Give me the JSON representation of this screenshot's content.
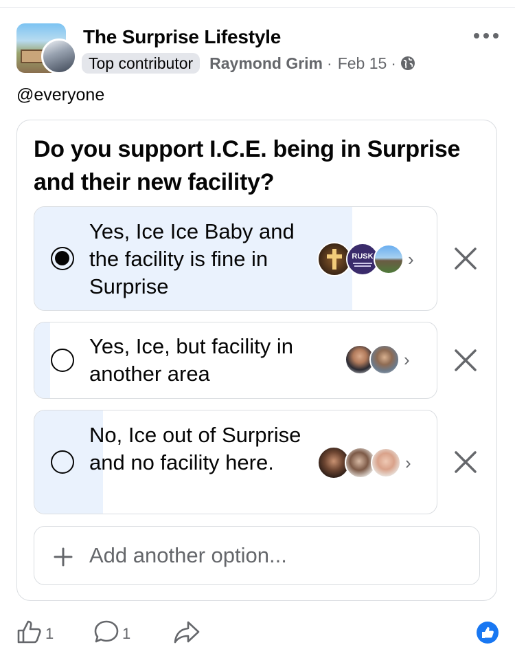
{
  "post": {
    "group_name": "The Surprise Lifestyle",
    "badge": "Top contributor",
    "author": "Raymond Grim",
    "date": "Feb 15",
    "text": "@everyone"
  },
  "poll": {
    "question": "Do you support I.C.E. being in Surprise and their new facility?",
    "options": [
      {
        "label": "Yes, Ice Ice Baby and the facility is fine in Surprise",
        "selected": true,
        "vote_share": 0.79,
        "voter_icons": [
          "cross-avatar",
          "rusk-logo-avatar",
          "building-photo-avatar"
        ]
      },
      {
        "label": "Yes, Ice, but facility in another area",
        "selected": false,
        "vote_share": 0.04,
        "voter_icons": [
          "man-avatar",
          "woman-sunglasses-avatar"
        ]
      },
      {
        "label": "No, Ice out of Surprise and no facility here.",
        "selected": false,
        "vote_share": 0.17,
        "voter_icons": [
          "woman-avatar",
          "couple-avatar",
          "blonde-woman-avatar"
        ]
      }
    ],
    "add_option": "Add another option..."
  },
  "actions": {
    "like_count": "1",
    "comment_count": "1"
  },
  "colors": {
    "accent": "#1877f2",
    "poll_fill": "#eaf2fd",
    "secondary_text": "#65676b"
  },
  "rusk_text": "RUSK"
}
